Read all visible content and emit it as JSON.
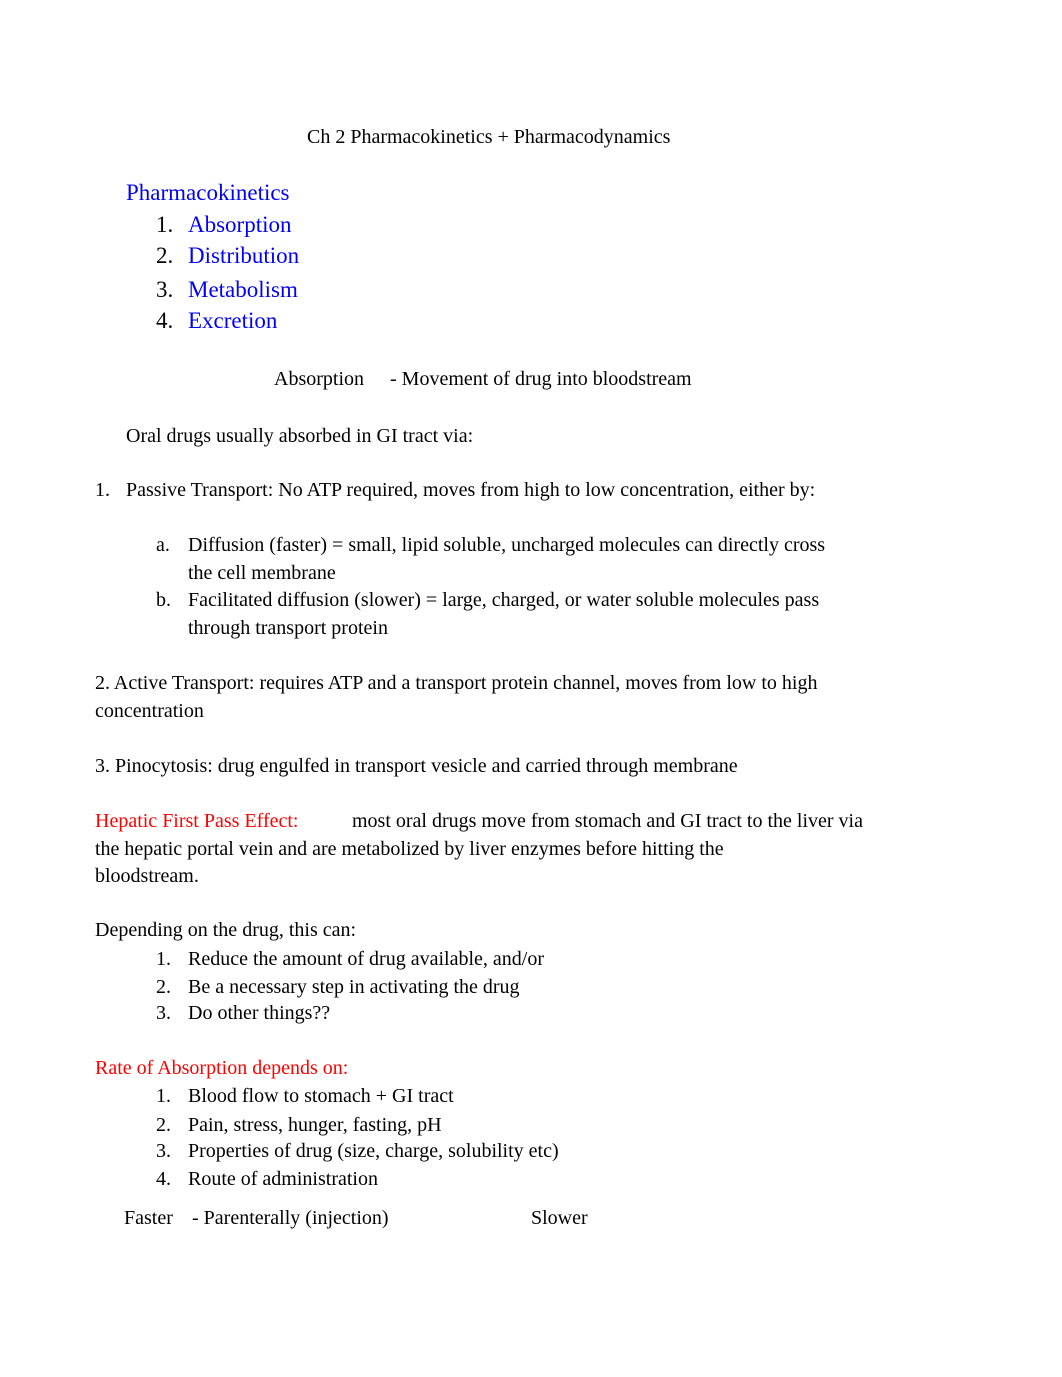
{
  "title": "Ch 2 Pharmacokinetics + Pharmacodynamics",
  "pharmacokinetics": {
    "heading": "Pharmacokinetics",
    "items": [
      {
        "num": "1.",
        "label": "Absorption"
      },
      {
        "num": "2.",
        "label": "Distribution"
      },
      {
        "num": "3.",
        "label": "Metabolism"
      },
      {
        "num": "4.",
        "label": "Excretion"
      }
    ]
  },
  "absorption": {
    "term": "Absorption",
    "definition": "- Movement of drug into bloodstream"
  },
  "oral_intro": "Oral drugs usually absorbed in GI tract via:",
  "passive": {
    "num": "1.",
    "text": "Passive Transport: No ATP required, moves from high to low concentration, either by:",
    "subitems": [
      {
        "num": "a.",
        "line1": "Diffusion (faster) = small, lipid soluble, uncharged molecules can directly cross",
        "line2": "the cell membrane"
      },
      {
        "num": "b.",
        "line1": "Facilitated diffusion (slower) = large, charged, or water soluble molecules pass",
        "line2": "through transport protein"
      }
    ]
  },
  "active": {
    "line1": "2. Active Transport: requires ATP and a transport protein channel, moves from low to high",
    "line2": "concentration"
  },
  "pinocytosis": "3. Pinocytosis: drug engulfed in transport vesicle and carried through membrane",
  "hepatic": {
    "label": "Hepatic First Pass Effect:",
    "line1": "most oral drugs move from stomach and GI tract to the liver via",
    "line2": "the hepatic portal vein and are metabolized by liver enzymes before hitting the",
    "line3": "bloodstream."
  },
  "depending": {
    "intro": "Depending on the drug, this can:",
    "items": [
      {
        "num": "1.",
        "label": "Reduce the amount of drug available, and/or"
      },
      {
        "num": "2.",
        "label": "Be a necessary step in activating the drug"
      },
      {
        "num": "3.",
        "label": "Do other things??"
      }
    ]
  },
  "rate": {
    "heading": "Rate of Absorption depends on:",
    "items": [
      {
        "num": "1.",
        "label": "Blood flow to stomach + GI tract"
      },
      {
        "num": "2.",
        "label": "Pain, stress, hunger, fasting, pH"
      },
      {
        "num": "3.",
        "label": "Properties of drug (size, charge, solubility etc)"
      },
      {
        "num": "4.",
        "label": "Route of administration"
      }
    ]
  },
  "route": {
    "faster": "Faster",
    "parenteral": "- Parenterally (injection)",
    "slower": "Slower"
  },
  "colors": {
    "heading_blue": "#0000ff",
    "highlight_red": "#ff0000",
    "text": "#000000"
  }
}
